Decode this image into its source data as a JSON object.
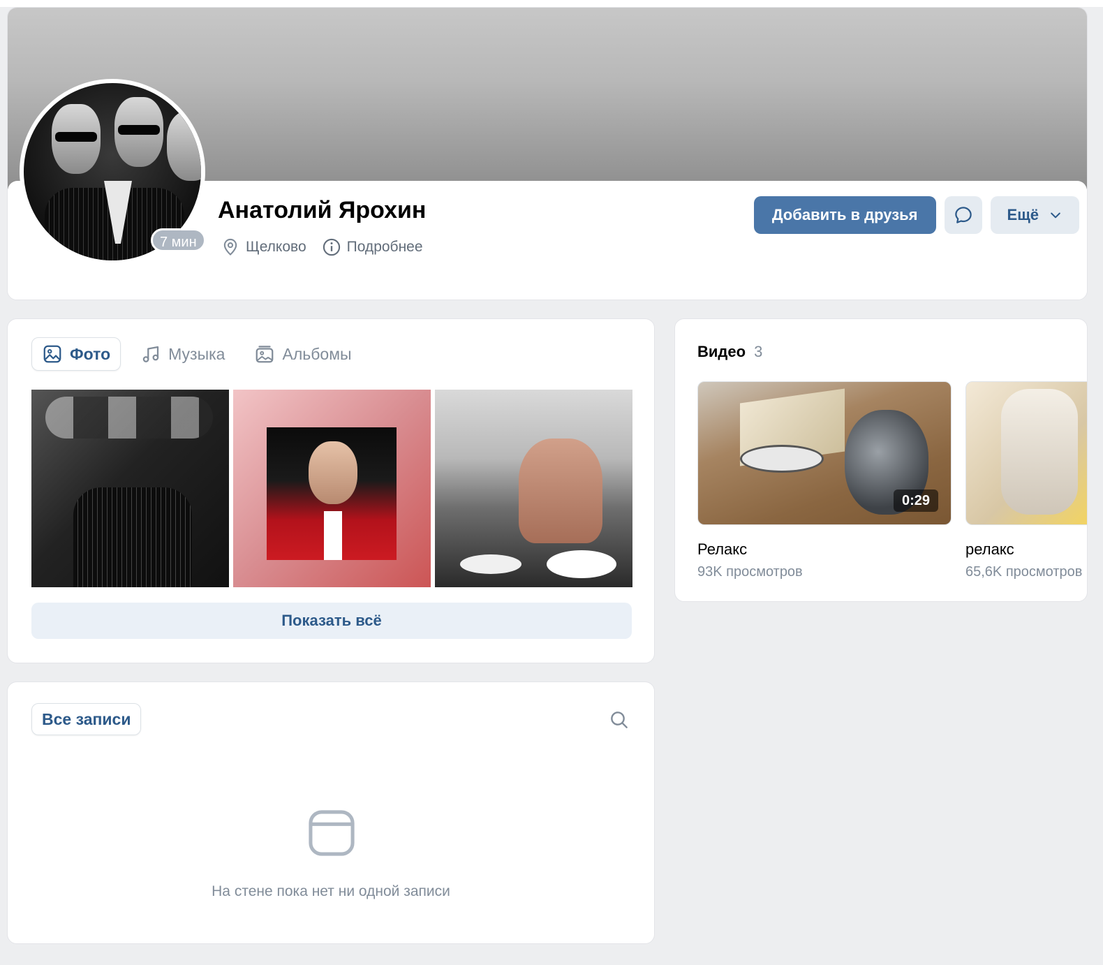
{
  "profile": {
    "name": "Анатолий Ярохин",
    "online_badge": "7 мин",
    "city": "Щелково",
    "details_label": "Подробнее",
    "add_friend_label": "Добавить в друзья",
    "more_label": "Ещё",
    "message_icon": "message-bubble-icon"
  },
  "photos": {
    "tabs": [
      {
        "label": "Фото",
        "icon": "photo-icon",
        "active": true
      },
      {
        "label": "Музыка",
        "icon": "music-note-icon",
        "active": false
      },
      {
        "label": "Альбомы",
        "icon": "album-icon",
        "active": false
      }
    ],
    "show_all_label": "Показать всё"
  },
  "videos": {
    "title": "Видео",
    "count": "3",
    "items": [
      {
        "title": "Релакс",
        "views": "93K просмотров",
        "duration": "0:29"
      },
      {
        "title": "релакс",
        "views": "65,6K просмотров",
        "duration": ""
      }
    ]
  },
  "wall": {
    "tab_label": "Все записи",
    "empty_text": "На стене пока нет ни одной записи"
  },
  "colors": {
    "accent": "#4a76a8",
    "link": "#2d5a8a",
    "muted": "#818c99",
    "background": "#edeef0"
  }
}
